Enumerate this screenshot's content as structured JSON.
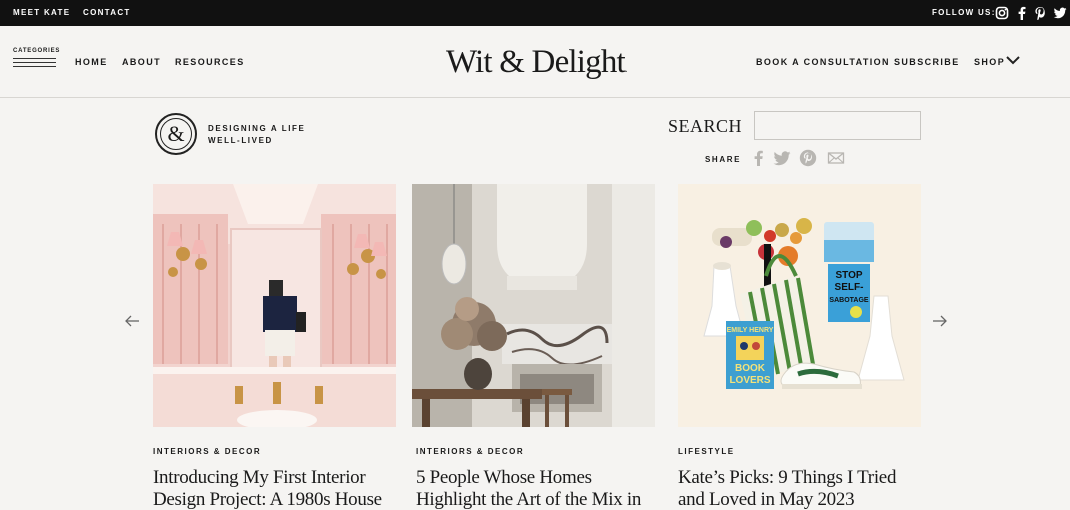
{
  "topbar": {
    "links": [
      "MEET KATE",
      "CONTACT"
    ],
    "follow_label": "FOLLOW US:",
    "social_icons": [
      "instagram-icon",
      "facebook-icon",
      "pinterest-icon",
      "twitter-icon"
    ]
  },
  "header": {
    "categories_label": "CATEGORIES",
    "nav_left": [
      "HOME",
      "ABOUT",
      "RESOURCES"
    ],
    "logo_text": "Wit & Delight",
    "logo_dot": ".",
    "nav_right": [
      "BOOK A CONSULTATION",
      "SUBSCRIBE",
      "SHOP"
    ]
  },
  "tagline": {
    "badge": "&",
    "line1": "DESIGNING A LIFE",
    "line2": "WELL-LIVED"
  },
  "search": {
    "label": "SEARCH",
    "value": "",
    "placeholder": ""
  },
  "share": {
    "label": "SHARE",
    "icons": [
      "facebook-icon",
      "twitter-icon",
      "pinterest-icon",
      "email-icon"
    ]
  },
  "carousel": {
    "prev_icon": "arrow-left-icon",
    "next_icon": "arrow-right-icon",
    "cards": [
      {
        "category": "INTERIORS & DECOR",
        "title_line1": "Introducing My First Interior",
        "title_line2": "Design Project: A 1980s House"
      },
      {
        "category": "INTERIORS & DECOR",
        "title_line1": "5 People Whose Homes",
        "title_line2": "Highlight the Art of the Mix in"
      },
      {
        "category": "LIFESTYLE",
        "title_line1": "Kate’s Picks: 9 Things I Tried",
        "title_line2": "and Loved in May 2023"
      }
    ],
    "image3_text": {
      "book_author": "EMILY HENRY",
      "book_title_1": "BOOK",
      "book_title_2": "LOVERS",
      "book2_line1": "STOP",
      "book2_line2": "SELF-",
      "book2_line3": "SABOTAGE"
    }
  },
  "colors": {
    "background": "#f5f4f2",
    "topbar": "#111111",
    "text": "#1a1a1a",
    "icon_gray": "#b8b6b2"
  }
}
